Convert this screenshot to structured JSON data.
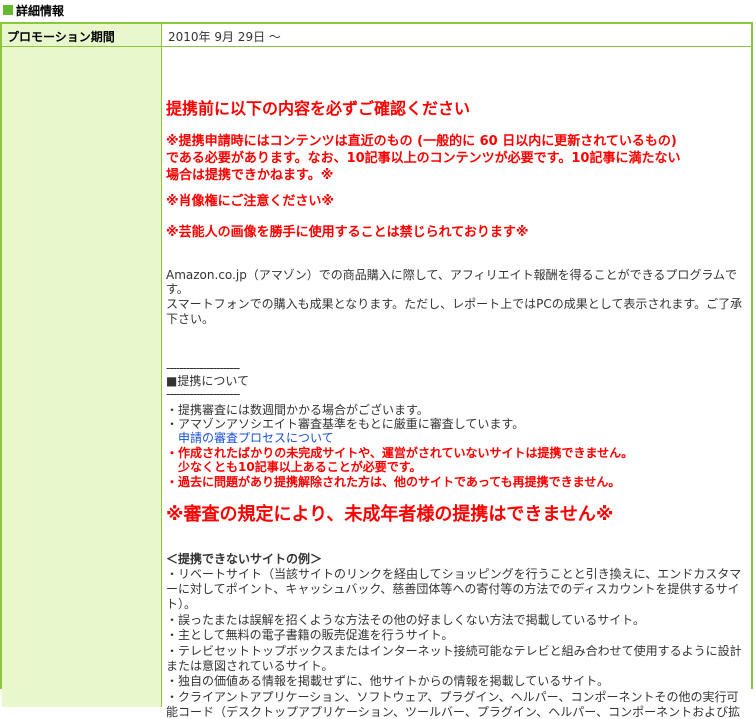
{
  "section": {
    "title": "詳細情報"
  },
  "promo": {
    "label": "プロモーション期間",
    "value": "2010年 9月 29日 ～"
  },
  "notice": {
    "heading": "提携前に以下の内容を必ずご確認ください",
    "content_line1": "※提携申請時にはコンテンツは直近のもの (一般的に 60 日以内に更新されているもの)",
    "content_line2": "である必要があります。なお、10記事以上のコンテンツが必要です。10記事に満たない",
    "content_line3": "場合は提携できかねます。※",
    "portrait": "※肖像権にご注意ください※",
    "celebrity": "※芸能人の画像を勝手に使用することは禁じられております※"
  },
  "description": {
    "line1": "Amazon.co.jp（アマゾン）での商品購入に際して、アフィリエイト報酬を得ることができるプログラムで",
    "line2": "す。",
    "line3": "スマートフォンでの購入も成果となります。ただし、レポート上ではPCの成果として表示されます。ご了承",
    "line4": "下さい。"
  },
  "partnership": {
    "divider": "----------------------",
    "title": "■提携について",
    "bullet1": "・提携審査には数週間かかる場合がございます。",
    "bullet2": "・アマゾンアソシエイト審査基準をもとに厳重に審査しています。",
    "link": "申請の審査プロセスについて",
    "red1_line1": "・作成されたばかりの未完成サイトや、運営がされていないサイトは提携できません。",
    "red1_line2": "少なくとも10記事以上あることが必要です。",
    "red2": "・過去に問題があり提携解除された方は、他のサイトであっても再提携できません。"
  },
  "minor_notice": "※審査の規定により、未成年者様の提携はできません※",
  "examples": {
    "title": "＜提携できないサイトの例＞",
    "i1_l1": "・リベートサイト（当該サイトのリンクを経由してショッピングを行うことと引き換えに、エンドカスタマ",
    "i1_l2": "ーに対してポイント、キャッシュバック、慈善団体等への寄付等の方法でのディスカウントを提供するサイ",
    "i1_l3": "ト）。",
    "i2": "・誤ったまたは誤解を招くような方法その他の好ましくない方法で掲載しているサイト。",
    "i3": "・主として無料の電子書籍の販売促進を行うサイト。",
    "i4_l1": "・テレビセットトップボックスまたはインターネット接続可能なテレビと組み合わせて使用するように設計",
    "i4_l2": "または意図されているサイト。",
    "i5": "・独自の価値ある情報を掲載せずに、他サイトからの情報を掲載しているサイト。",
    "i6_l1": "・クライアントアプリケーション、ソフトウェア、プラグイン、ヘルパー、コンポーネントその他の実行可",
    "i6_l2": "能コード（デスクトップアプリケーション、ツールバー、プラグイン、ヘルパー、コンポーネントおよび拡"
  },
  "colors": {
    "accent_green": "#8cc63f",
    "header_bg": "#e9f7cd",
    "warning_red": "#ff0000",
    "link_blue": "#1a4fd6"
  }
}
